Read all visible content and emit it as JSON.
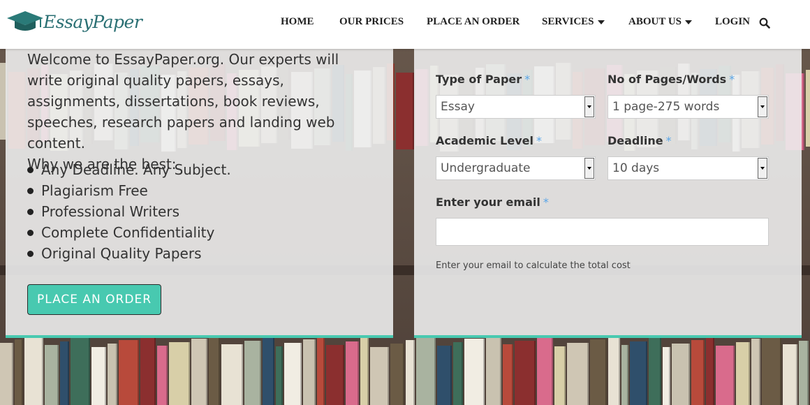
{
  "header": {
    "logo": {
      "text": "EssayPaper",
      "icon": "graduation-cap-icon",
      "color": "#2a6f73"
    },
    "nav": [
      {
        "label": "HOME"
      },
      {
        "label": "OUR PRICES"
      },
      {
        "label": "PLACE AN ORDER"
      },
      {
        "label": "SERVICES",
        "dropdown": true
      },
      {
        "label": "ABOUT US",
        "dropdown": true
      },
      {
        "label": "LOGIN"
      }
    ],
    "search_icon": "search-icon"
  },
  "intro": {
    "paragraph": "Welcome to EssayPaper.org. Our experts will write original quality papers, essays, assignments, dissertations, book reviews, speeches, research papers and landing web content.",
    "why": "Why we are the best:",
    "bullets": [
      "Any Deadline. Any Subject.",
      "Plagiarism Free",
      "Professional Writers",
      "Complete Confidentiality",
      "Original Quality Papers"
    ],
    "order_button": "PLACE AN ORDER"
  },
  "form": {
    "type_of_paper": {
      "label": "Type of Paper",
      "value": "Essay"
    },
    "pages": {
      "label": "No of Pages/Words",
      "value": "1 page-275 words"
    },
    "academic_level": {
      "label": "Academic Level",
      "value": "Undergraduate"
    },
    "deadline": {
      "label": "Deadline",
      "value": "10 days"
    },
    "email": {
      "label": "Enter your email",
      "value": ""
    },
    "required_mark": "*",
    "note": "Enter your email to calculate the total cost"
  },
  "colors": {
    "accent": "#48c9b0",
    "required": "#5aa6e8"
  }
}
